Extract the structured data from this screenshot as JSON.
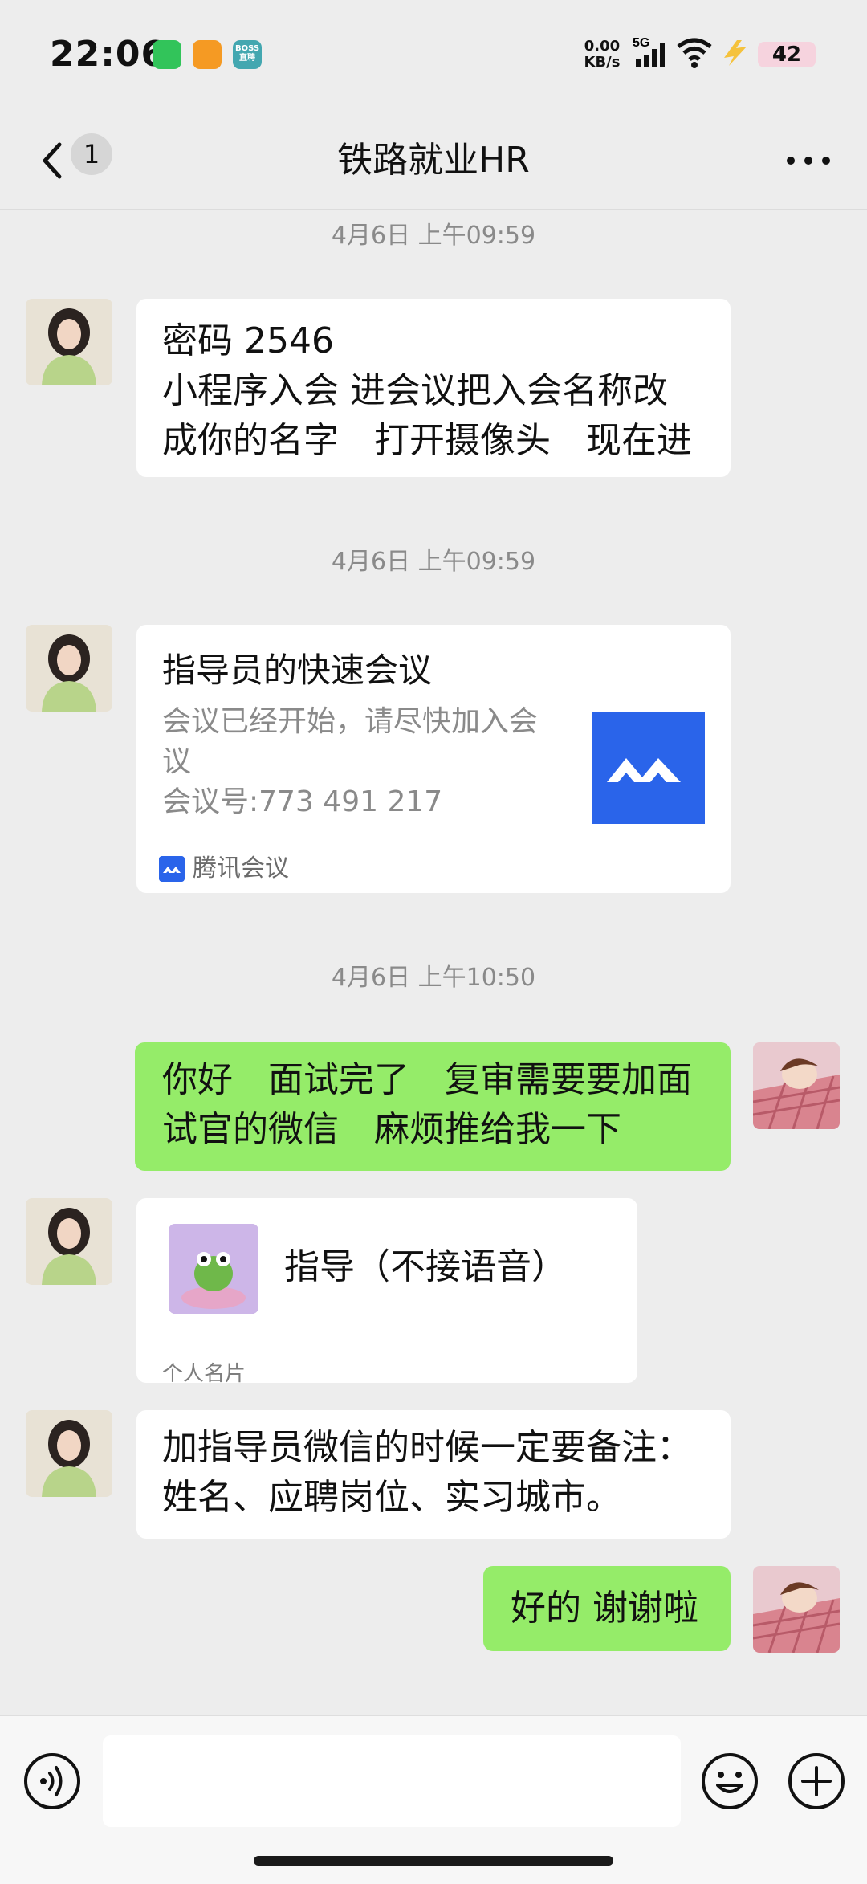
{
  "status_bar": {
    "time": "22:06",
    "net_speed_value": "0.00",
    "net_speed_unit": "KB/s",
    "network": "5G",
    "battery": "42",
    "boss_icon_text": "BOSS\n直聘"
  },
  "nav": {
    "unread_count": "1",
    "title": "铁路就业HR"
  },
  "messages": {
    "ts1": "4月6日 上午09:59",
    "msg1_lines": [
      "密码 2546",
      "小程序入会 进会议把入会名称改",
      "成你的名字　打开摄像头　现在进"
    ],
    "ts2": "4月6日 上午09:59",
    "meeting_card": {
      "title": "指导员的快速会议",
      "desc_line1": "会议已经开始，请尽快加入会",
      "desc_line2": "议",
      "desc_line3": "会议号:773 491 217",
      "source": "腾讯会议"
    },
    "ts3": "4月6日 上午10:50",
    "msg3_lines": [
      "你好　面试完了　复审需要要加面",
      "试官的微信　麻烦推给我一下"
    ],
    "contact_card": {
      "name": "指导（不接语音）",
      "type": "个人名片"
    },
    "msg5_lines": [
      "加指导员微信的时候一定要备注：",
      "姓名、应聘岗位、实习城市。"
    ],
    "msg6": "好的 谢谢啦"
  },
  "input_bar": {
    "placeholder": ""
  }
}
